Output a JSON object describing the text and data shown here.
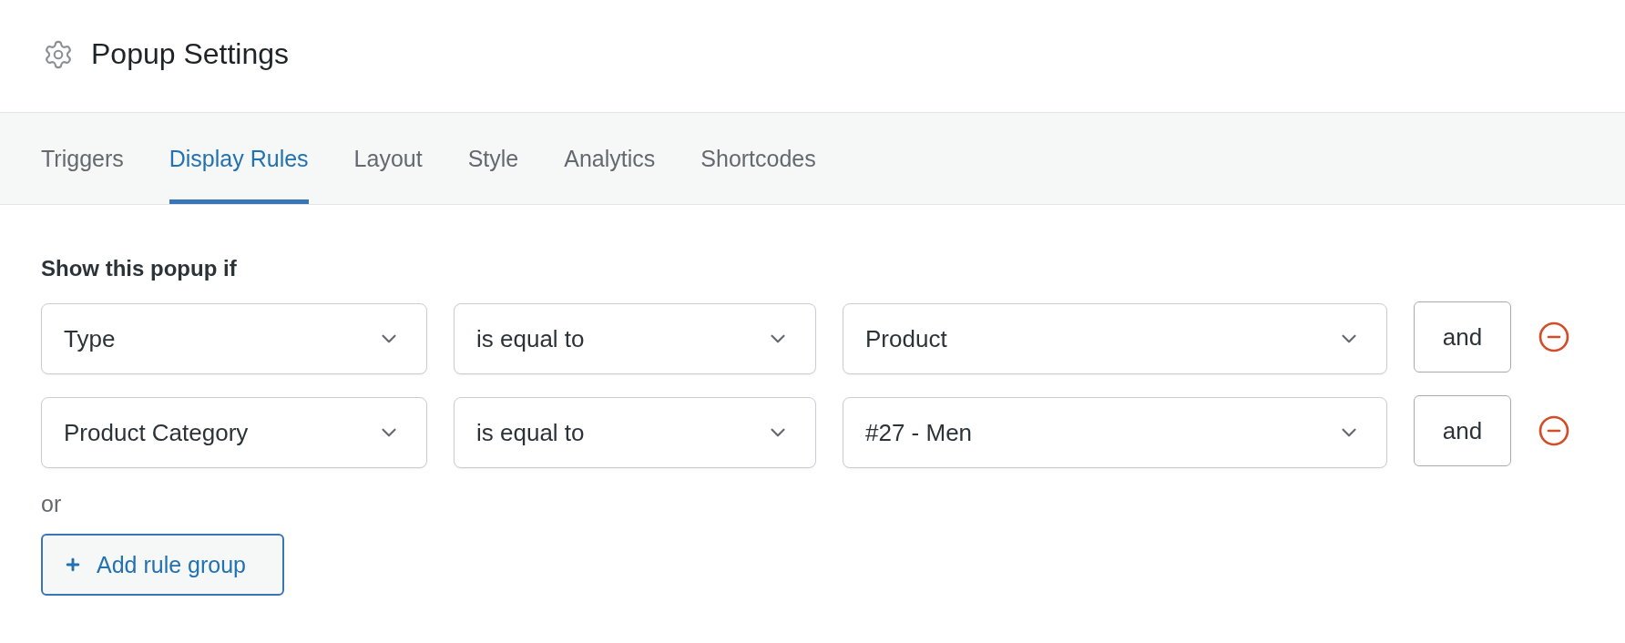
{
  "header": {
    "title": "Popup Settings"
  },
  "tabs": [
    {
      "label": "Triggers",
      "selected": false
    },
    {
      "label": "Display Rules",
      "selected": true
    },
    {
      "label": "Layout",
      "selected": false
    },
    {
      "label": "Style",
      "selected": false
    },
    {
      "label": "Analytics",
      "selected": false
    },
    {
      "label": "Shortcodes",
      "selected": false
    }
  ],
  "rules": {
    "heading": "Show this popup if",
    "rows": [
      {
        "field": "Type",
        "operator": "is equal to",
        "value": "Product",
        "join": "and"
      },
      {
        "field": "Product Category",
        "operator": "is equal to",
        "value": "#27 - Men",
        "join": "and"
      }
    ],
    "separator": "or",
    "add_button": "Add rule group"
  }
}
